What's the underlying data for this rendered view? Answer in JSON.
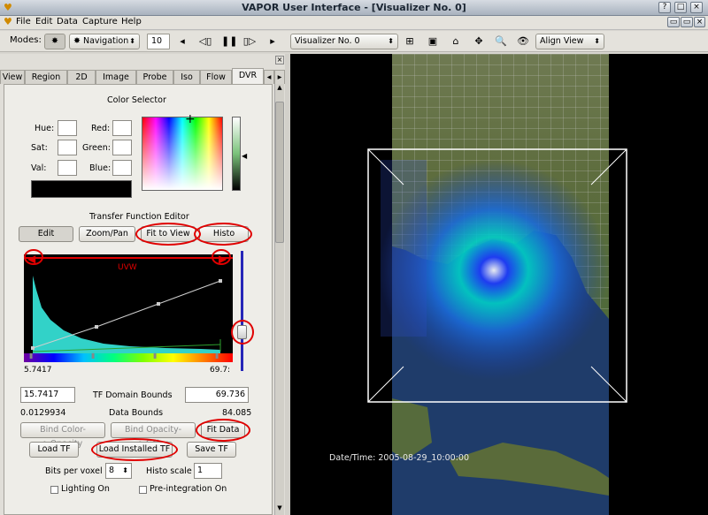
{
  "window": {
    "title": "VAPOR User Interface - [Visualizer No. 0]",
    "buttons": [
      "?",
      "□",
      "×"
    ],
    "mdi_buttons": [
      "▭",
      "▭",
      "×"
    ]
  },
  "menu": [
    "File",
    "Edit",
    "Data",
    "Capture",
    "Help"
  ],
  "toolbar": {
    "modes_label": "Modes:",
    "mode_value": "Navigation",
    "frame_value": "10",
    "visualizer_value": "Visualizer No. 0",
    "align_value": "Align View"
  },
  "tabs": [
    "View",
    "Region",
    "2D",
    "Image",
    "Probe",
    "Iso",
    "Flow",
    "DVR"
  ],
  "color_selector": {
    "title": "Color Selector",
    "hue_label": "Hue:",
    "sat_label": "Sat:",
    "val_label": "Val:",
    "red_label": "Red:",
    "green_label": "Green:",
    "blue_label": "Blue:"
  },
  "tf_editor": {
    "title": "Transfer Function Editor",
    "edit_btn": "Edit",
    "zoom_btn": "Zoom/Pan",
    "fit_view_btn": "Fit to View",
    "histo_btn": "Histo",
    "var_name": "UVW",
    "axis_min": "5.7417",
    "axis_max": "69.7:",
    "tf_min": "15.7417",
    "tf_domain_label": "TF Domain Bounds",
    "tf_max": "69.736",
    "data_min": "0.0129934",
    "data_bounds_label": "Data Bounds",
    "data_max": "84.085",
    "bind_color_btn": "Bind Color->Opacity",
    "bind_opacity_btn": "Bind Opacity->Color",
    "fit_data_btn": "Fit Data",
    "load_tf_btn": "Load TF",
    "load_installed_btn": "Load Installed TF",
    "save_tf_btn": "Save TF",
    "bits_label": "Bits per voxel",
    "bits_value": "8",
    "histo_scale_label": "Histo scale",
    "histo_scale_value": "1",
    "lighting_label": "Lighting On",
    "preint_label": "Pre-integration On"
  },
  "viz": {
    "datetime": "Date/Time: 2005-08-29_10:00:00"
  },
  "colors": {
    "highlight": "#e00000",
    "histogram": "#32d2c8",
    "tf_line": "#2ea12e"
  }
}
